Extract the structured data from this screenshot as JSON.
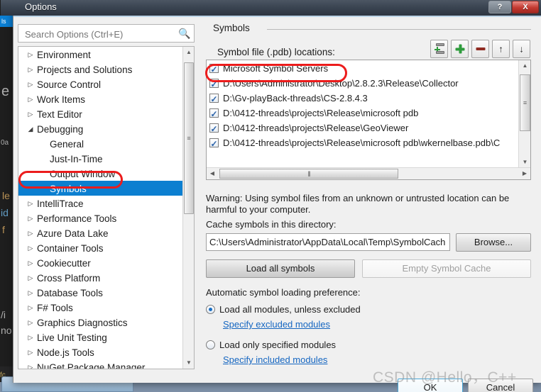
{
  "window": {
    "title": "Options",
    "help_button": "?",
    "close_button": "X"
  },
  "background": {
    "tool_tab": "ls",
    "status_snippet": "fc",
    "code_ghosts": [
      "e",
      "0a",
      "le",
      "id",
      "f",
      "/i",
      "no"
    ]
  },
  "search": {
    "placeholder": "Search Options (Ctrl+E)",
    "value": "",
    "icon": "search-icon"
  },
  "tree": {
    "items": [
      {
        "label": "Environment",
        "level": 0,
        "expandable": true,
        "expanded": false,
        "selected": false
      },
      {
        "label": "Projects and Solutions",
        "level": 0,
        "expandable": true,
        "expanded": false,
        "selected": false
      },
      {
        "label": "Source Control",
        "level": 0,
        "expandable": true,
        "expanded": false,
        "selected": false
      },
      {
        "label": "Work Items",
        "level": 0,
        "expandable": true,
        "expanded": false,
        "selected": false
      },
      {
        "label": "Text Editor",
        "level": 0,
        "expandable": true,
        "expanded": false,
        "selected": false
      },
      {
        "label": "Debugging",
        "level": 0,
        "expandable": true,
        "expanded": true,
        "selected": false
      },
      {
        "label": "General",
        "level": 1,
        "expandable": false,
        "expanded": false,
        "selected": false
      },
      {
        "label": "Just-In-Time",
        "level": 1,
        "expandable": false,
        "expanded": false,
        "selected": false
      },
      {
        "label": "Output Window",
        "level": 1,
        "expandable": false,
        "expanded": false,
        "selected": false
      },
      {
        "label": "Symbols",
        "level": 1,
        "expandable": false,
        "expanded": false,
        "selected": true
      },
      {
        "label": "IntelliTrace",
        "level": 0,
        "expandable": true,
        "expanded": false,
        "selected": false
      },
      {
        "label": "Performance Tools",
        "level": 0,
        "expandable": true,
        "expanded": false,
        "selected": false
      },
      {
        "label": "Azure Data Lake",
        "level": 0,
        "expandable": true,
        "expanded": false,
        "selected": false
      },
      {
        "label": "Container Tools",
        "level": 0,
        "expandable": true,
        "expanded": false,
        "selected": false
      },
      {
        "label": "Cookiecutter",
        "level": 0,
        "expandable": true,
        "expanded": false,
        "selected": false
      },
      {
        "label": "Cross Platform",
        "level": 0,
        "expandable": true,
        "expanded": false,
        "selected": false
      },
      {
        "label": "Database Tools",
        "level": 0,
        "expandable": true,
        "expanded": false,
        "selected": false
      },
      {
        "label": "F# Tools",
        "level": 0,
        "expandable": true,
        "expanded": false,
        "selected": false
      },
      {
        "label": "Graphics Diagnostics",
        "level": 0,
        "expandable": true,
        "expanded": false,
        "selected": false
      },
      {
        "label": "Live Unit Testing",
        "level": 0,
        "expandable": true,
        "expanded": false,
        "selected": false
      },
      {
        "label": "Node.js Tools",
        "level": 0,
        "expandable": true,
        "expanded": false,
        "selected": false
      },
      {
        "label": "NuGet Package Manager",
        "level": 0,
        "expandable": true,
        "expanded": false,
        "selected": false
      }
    ],
    "collapsed_arrow": "▷",
    "expanded_arrow": "◢"
  },
  "pane": {
    "title": "Symbols",
    "locations_label": "Symbol file (.pdb) locations:",
    "toolbar": [
      {
        "name": "new-symbol-server-button",
        "tooltip": "New Microsoft Symbol Servers Location"
      },
      {
        "name": "add-location-button",
        "tooltip": "New Location"
      },
      {
        "name": "remove-location-button",
        "tooltip": "Delete Location"
      },
      {
        "name": "move-up-button",
        "glyph": "↑"
      },
      {
        "name": "move-down-button",
        "glyph": "↓"
      }
    ],
    "locations": [
      {
        "label": "Microsoft Symbol Servers",
        "checked": true,
        "highlighted": true
      },
      {
        "label": "D:\\Users\\Administrator\\Desktop\\2.8.2.3\\Release\\Collector",
        "checked": true,
        "highlighted": false
      },
      {
        "label": "D:\\Gv-playBack-threads\\CS-2.8.4.3",
        "checked": true,
        "highlighted": false
      },
      {
        "label": "D:\\0412-threads\\projects\\Release\\microsoft pdb",
        "checked": true,
        "highlighted": false
      },
      {
        "label": "D:\\0412-threads\\projects\\Release\\GeoViewer",
        "checked": true,
        "highlighted": false
      },
      {
        "label": "D:\\0412-threads\\projects\\Release\\microsoft pdb\\wkernelbase.pdb\\C",
        "checked": true,
        "highlighted": false
      }
    ],
    "warning_line1": "Warning: Using symbol files from an unknown or untrusted location can be",
    "warning_line2": "harmful to your computer.",
    "cache_label": "Cache symbols in this directory:",
    "cache_value": "C:\\Users\\Administrator\\AppData\\Local\\Temp\\SymbolCach",
    "browse_label": "Browse...",
    "load_all_symbols_label": "Load all symbols",
    "empty_symbol_cache_label": "Empty Symbol Cache",
    "auto_pref_label": "Automatic symbol loading preference:",
    "radio_all_label": "Load all modules, unless excluded",
    "radio_all_selected": true,
    "link_excluded": "Specify excluded modules",
    "radio_only_label": "Load only specified modules",
    "radio_only_selected": false,
    "link_included": "Specify included modules"
  },
  "footer": {
    "ok_label": "OK",
    "cancel_label": "Cancel"
  },
  "watermark": {
    "text": "CSDN @Hello，C++"
  },
  "colors": {
    "selection_blue": "#0c7fd0",
    "annotation_red": "#ec1c1c",
    "link_blue": "#1566c1",
    "dialog_bg": "#f0f0f0",
    "close_red": "#c33a31"
  }
}
